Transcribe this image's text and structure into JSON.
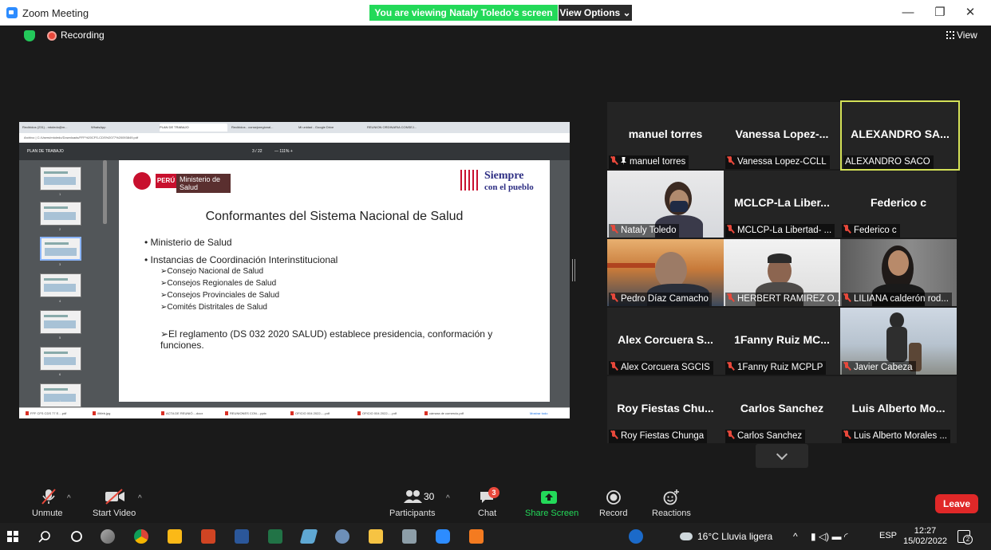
{
  "window": {
    "title": "Zoom Meeting",
    "viewing_banner": "You are viewing Nataly Toledo's screen",
    "view_options": "View Options ⌄",
    "minimize": "—",
    "maximize": "❐",
    "close": "✕"
  },
  "status": {
    "recording": "Recording",
    "view": "View"
  },
  "shared_screen": {
    "browser_tabs": [
      "Recibidos (231) - mtoledo@m...",
      "WhatsApp",
      "PLAN DE TRABAJO",
      "Recibidos - consejoregional...",
      "Mi unidad - Google Drive",
      "REUNION ORDINARIA CONSEJ..."
    ],
    "address": "Archivo | C:/Users/mtoledo/Downloads/FFF%20CFS-CDS%2077%20093849.pdf",
    "pdf_name": "PLAN DE TRABAJO",
    "pdf_page": "3 / 22",
    "pdf_zoom": "— 111% +",
    "slide": {
      "logo_country": "PERÚ",
      "logo_ministry": "Ministerio de Salud",
      "logo_slogan_1": "Siempre",
      "logo_slogan_2": "con el pueblo",
      "title": "Conformantes del Sistema Nacional de Salud",
      "bullets": [
        "• Ministerio de Salud",
        "• Instancias de Coordinación Interinstitucional"
      ],
      "sub_items": [
        "➢Consejo Nacional de Salud",
        "➢Consejos Regionales de Salud",
        "➢Consejos Provinciales de Salud",
        "➢Comités Distritales de Salud"
      ],
      "paragraph": "➢El reglamento (DS 032 2020 SALUD) establece presidencia, conformación y funciones."
    },
    "thumbnail_numbers": [
      "1",
      "2",
      "3",
      "4",
      "5",
      "6",
      "7"
    ],
    "downloads": [
      "FFF CFS CDS 77 E....pdf",
      "iiWeb.jpg",
      "ACTA DE REUNIÓ....docx",
      "REUNIONES CON....pptx",
      "OFICIO 004 2022-....pdf",
      "OFICIO 004 2022-....pdf",
      "cámara de comercio.pdf"
    ],
    "show_all": "Mostrar todo"
  },
  "participants": [
    {
      "display": "manuel torres",
      "label": "manuel torres",
      "muted": true,
      "pinned": true,
      "video": false,
      "active": false
    },
    {
      "display": "Vanessa Lopez-...",
      "label": "Vanessa Lopez-CCLL",
      "muted": true,
      "video": false,
      "active": false
    },
    {
      "display": "ALEXANDRO SA...",
      "label": "ALEXANDRO SACO",
      "muted": false,
      "video": false,
      "active": true
    },
    {
      "display": "",
      "label": "Nataly Toledo",
      "muted": true,
      "video": true,
      "active": false
    },
    {
      "display": "MCLCP-La Liber...",
      "label": "MCLCP-La Libertad- ...",
      "muted": true,
      "video": false,
      "active": false
    },
    {
      "display": "Federico c",
      "label": "Federico c",
      "muted": true,
      "video": false,
      "active": false
    },
    {
      "display": "",
      "label": "Pedro Díaz Camacho",
      "muted": true,
      "video": true,
      "active": false
    },
    {
      "display": "",
      "label": "HERBERT RAMIREZ O...",
      "muted": true,
      "video": true,
      "active": false
    },
    {
      "display": "",
      "label": "LILIANA calderón rod...",
      "muted": true,
      "video": true,
      "active": false
    },
    {
      "display": "Alex Corcuera S...",
      "label": "Alex Corcuera SGCIS",
      "muted": true,
      "video": false,
      "active": false
    },
    {
      "display": "1Fanny Ruiz MC...",
      "label": "1Fanny Ruiz MCPLP",
      "muted": true,
      "video": false,
      "active": false
    },
    {
      "display": "",
      "label": "Javier Cabeza",
      "muted": true,
      "video": true,
      "active": false
    },
    {
      "display": "Roy Fiestas Chu...",
      "label": "Roy Fiestas Chunga",
      "muted": true,
      "video": false,
      "active": false
    },
    {
      "display": "Carlos Sanchez",
      "label": "Carlos Sanchez",
      "muted": true,
      "video": false,
      "active": false
    },
    {
      "display": "Luis Alberto Mo...",
      "label": "Luis Alberto Morales ...",
      "muted": true,
      "video": false,
      "active": false
    }
  ],
  "toolbar": {
    "unmute": "Unmute",
    "start_video": "Start Video",
    "participants": "Participants",
    "participants_count": "30",
    "chat": "Chat",
    "chat_badge": "3",
    "share_screen": "Share Screen",
    "record": "Record",
    "reactions": "Reactions",
    "leave": "Leave"
  },
  "taskbar": {
    "weather": "16°C  Lluvia ligera",
    "language": "ESP",
    "time": "12:27",
    "date": "15/02/2022",
    "notifications": "2"
  },
  "colors": {
    "zoom_blue": "#2d8cff",
    "viewing_green": "#23d959",
    "active_speaker": "#d4e157",
    "leave_red": "#e02828",
    "muted_red": "#e8483b"
  }
}
